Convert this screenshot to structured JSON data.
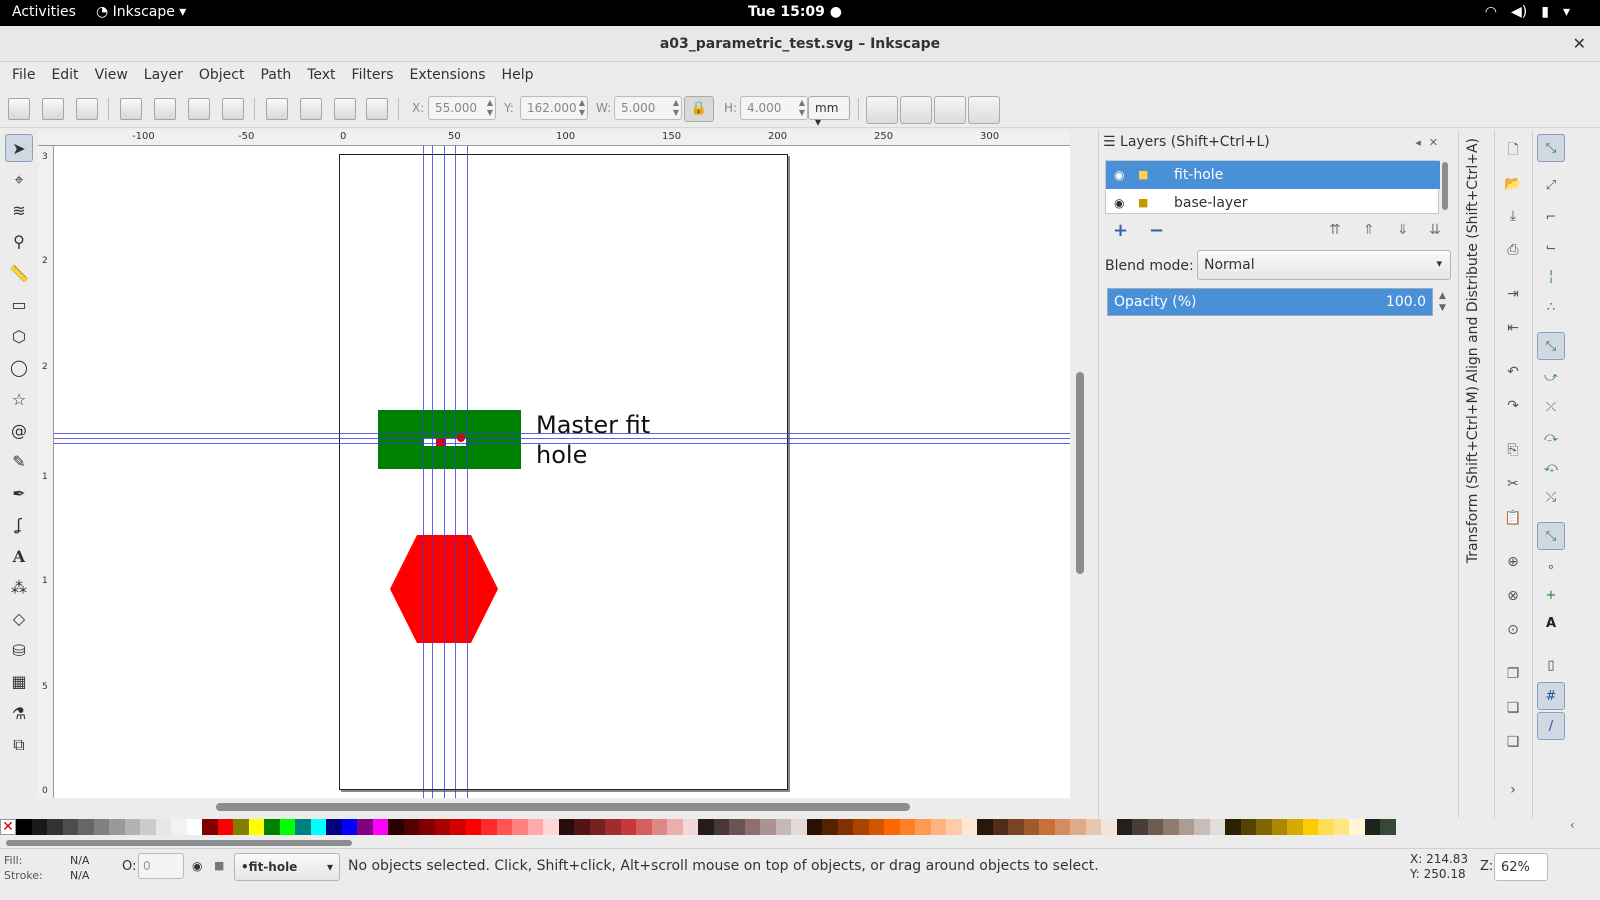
{
  "topbar": {
    "activities": "Activities",
    "app_menu": "Inkscape",
    "clock": "Tue 15:09"
  },
  "window": {
    "title": "a03_parametric_test.svg – Inkscape"
  },
  "menu": [
    "File",
    "Edit",
    "View",
    "Layer",
    "Object",
    "Path",
    "Text",
    "Filters",
    "Extensions",
    "Help"
  ],
  "toolbar": {
    "x_label": "X:",
    "x_value": "55.000",
    "y_label": "Y:",
    "y_value": "162.000",
    "w_label": "W:",
    "w_value": "5.000",
    "h_label": "H:",
    "h_value": "4.000",
    "unit": "mm"
  },
  "rulers": {
    "horizontal": [
      "-100",
      "-50",
      "0",
      "50",
      "100",
      "150",
      "200",
      "250",
      "300"
    ],
    "vertical": [
      "3",
      "2",
      "2",
      "1",
      "1",
      "5",
      "0"
    ]
  },
  "canvas": {
    "text_line1": "Master fit",
    "text_line2": "hole",
    "colors": {
      "green": "#008000",
      "red": "#ff0000",
      "guide": "#3a3adf"
    }
  },
  "layers_panel": {
    "title": "Layers (Shift+Ctrl+L)",
    "layers": [
      {
        "name": "fit-hole",
        "selected": true
      },
      {
        "name": "base-layer",
        "selected": false
      }
    ],
    "blend_label": "Blend mode:",
    "blend_value": "Normal",
    "opacity_label": "Opacity (%)",
    "opacity_value": "100.0"
  },
  "side_tabs": {
    "align": "Align and Distribute (Shift+Ctrl+A)",
    "transform": "Transform (Shift+Ctrl+M)"
  },
  "status": {
    "fill_label": "Fill:",
    "fill_value": "N/A",
    "stroke_label": "Stroke:",
    "stroke_value": "N/A",
    "opacity_label": "O:",
    "opacity_value": "0",
    "layer": "•fit-hole",
    "message": "No objects selected. Click, Shift+click, Alt+scroll mouse on top of objects, or drag around objects to select.",
    "x_coord": "X:  214.83",
    "y_coord": "Y:  250.18",
    "zoom_label": "Z:",
    "zoom_value": "62%"
  },
  "palette": [
    "#000000",
    "#1a1a1a",
    "#333333",
    "#4d4d4d",
    "#666666",
    "#808080",
    "#999999",
    "#b3b3b3",
    "#cccccc",
    "#e6e6e6",
    "#f2f2f2",
    "#ffffff",
    "#800000",
    "#ff0000",
    "#808000",
    "#ffff00",
    "#008000",
    "#00ff00",
    "#008080",
    "#00ffff",
    "#000080",
    "#0000ff",
    "#800080",
    "#ff00ff",
    "#2b0000",
    "#550000",
    "#800000",
    "#aa0000",
    "#d40000",
    "#ff0000",
    "#ff2a2a",
    "#ff5555",
    "#ff8080",
    "#ffaaaa",
    "#ffd5d5",
    "#280b0b",
    "#501616",
    "#782121",
    "#a02c2c",
    "#c83737",
    "#d35f5f",
    "#de8787",
    "#e9afaf",
    "#f4d7d7",
    "#241c1c",
    "#483737",
    "#6c5353",
    "#916f6f",
    "#ac9393",
    "#c8b7b7",
    "#e3dbdb",
    "#2b1100",
    "#552200",
    "#803300",
    "#aa4400",
    "#d45500",
    "#ff6600",
    "#ff7f2a",
    "#ff9955",
    "#ffb380",
    "#ffccaa",
    "#ffe6d5",
    "#28170b",
    "#502d16",
    "#784421",
    "#a05a2c",
    "#c87137",
    "#d38d5f",
    "#deaa87",
    "#e9c6af",
    "#f4e3d7",
    "#241f1c",
    "#483e37",
    "#6c5d53",
    "#917c6f",
    "#ac9d93",
    "#c8beb7",
    "#e3dedb",
    "#2b2200",
    "#554400",
    "#806600",
    "#aa8800",
    "#d4aa00",
    "#ffcc00",
    "#ffdd55",
    "#ffe680",
    "#fff6d5",
    "#1c241c",
    "#374837"
  ]
}
